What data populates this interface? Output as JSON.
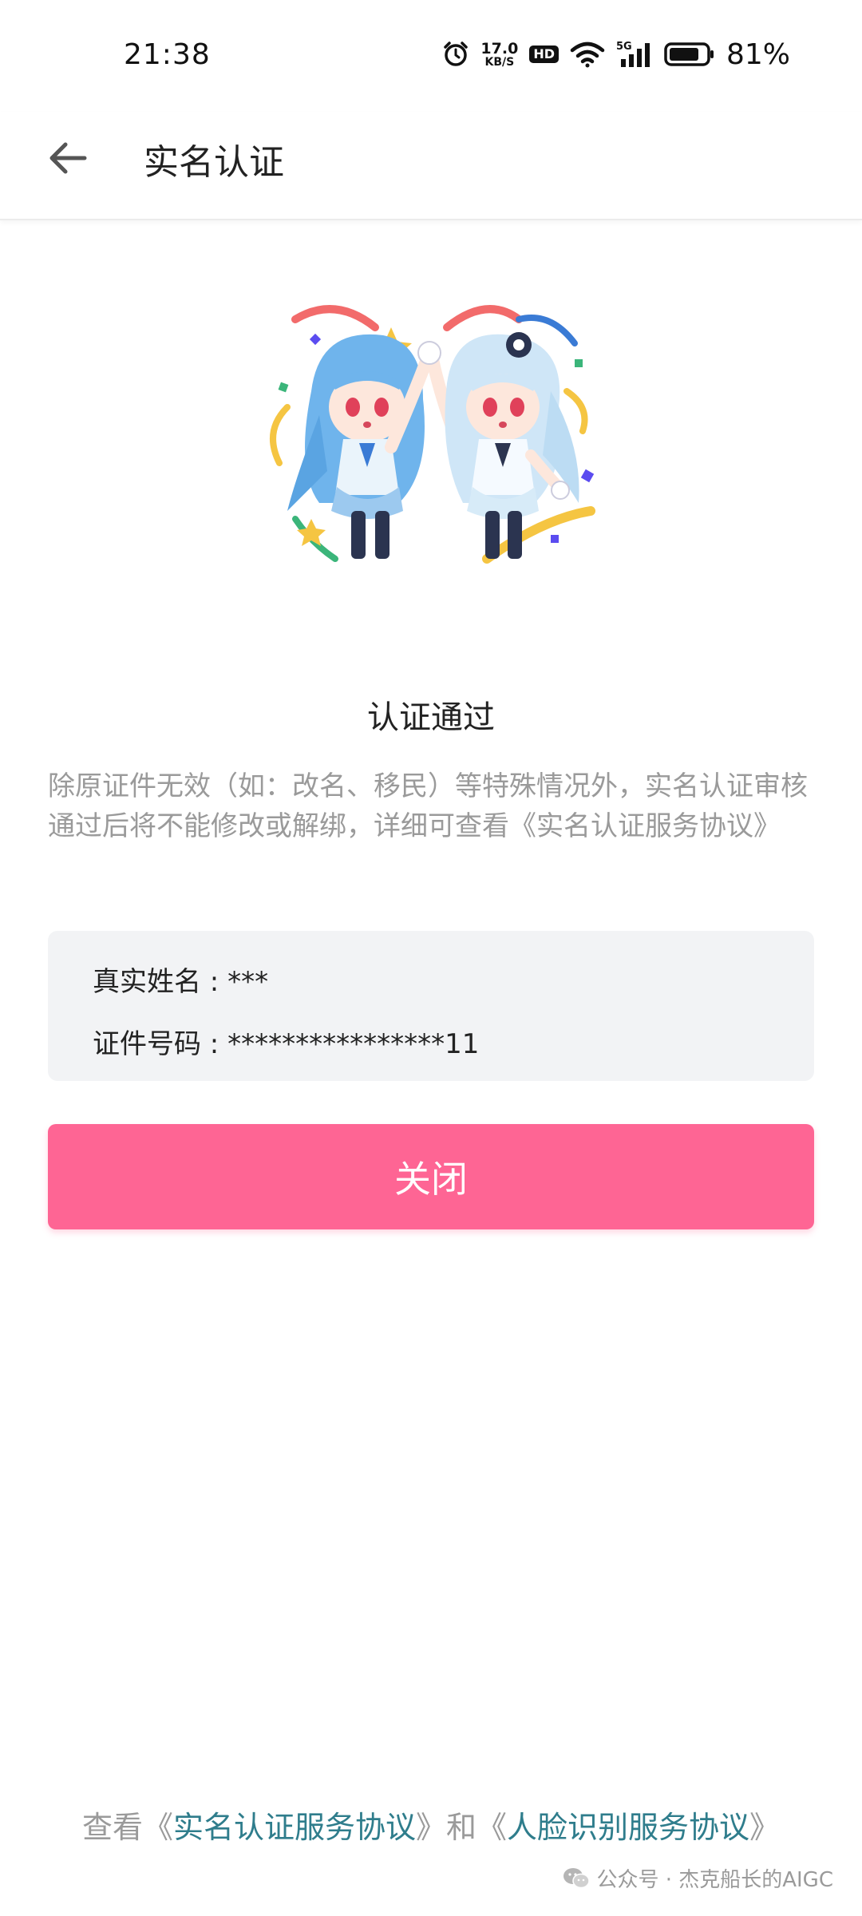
{
  "status_bar": {
    "time": "21:38",
    "net_speed_value": "17.0",
    "net_speed_unit": "KB/S",
    "hd_label": "HD",
    "signal_label": "5G",
    "battery_percent": "81%",
    "battery_level": 0.81
  },
  "app_bar": {
    "title": "实名认证"
  },
  "result": {
    "title": "认证通过",
    "notice": "除原证件无效（如：改名、移民）等特殊情况外，实名认证审核通过后将不能修改或解绑，详细可查看《实名认证服务协议》"
  },
  "info_card": {
    "name_label": "真实姓名 : ***",
    "id_label": "证件号码 : ****************11"
  },
  "close_button": {
    "label": "关闭"
  },
  "footer": {
    "prefix": "查看《",
    "link1": "实名认证服务协议",
    "mid": "》和《",
    "link2": "人脸识别服务协议",
    "suffix": "》"
  },
  "watermark": {
    "text": "公众号 · 杰克船长的AIGC"
  },
  "colors": {
    "accent": "#fe6594",
    "link": "#2f7d8c",
    "muted_text": "#9a9a9a",
    "card_bg": "#f2f3f5"
  },
  "icons": [
    "alarm-icon",
    "wifi-icon",
    "signal-icon",
    "battery-icon",
    "back-arrow-icon",
    "wechat-icon"
  ]
}
